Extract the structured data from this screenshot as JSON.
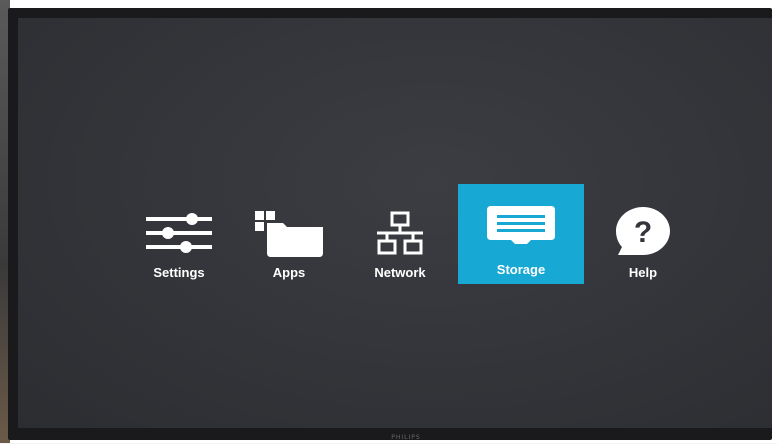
{
  "menu": {
    "items": [
      {
        "label": "Settings",
        "icon": "settings-sliders-icon",
        "selected": false
      },
      {
        "label": "Apps",
        "icon": "apps-folder-icon",
        "selected": false
      },
      {
        "label": "Network",
        "icon": "network-icon",
        "selected": false
      },
      {
        "label": "Storage",
        "icon": "storage-icon",
        "selected": true
      },
      {
        "label": "Help",
        "icon": "help-question-icon",
        "selected": false
      }
    ]
  },
  "colors": {
    "selection": "#17a8d4",
    "screen_background": "#34363b",
    "text": "#ffffff"
  },
  "brand": {
    "logo_text": "PHILIPS"
  }
}
